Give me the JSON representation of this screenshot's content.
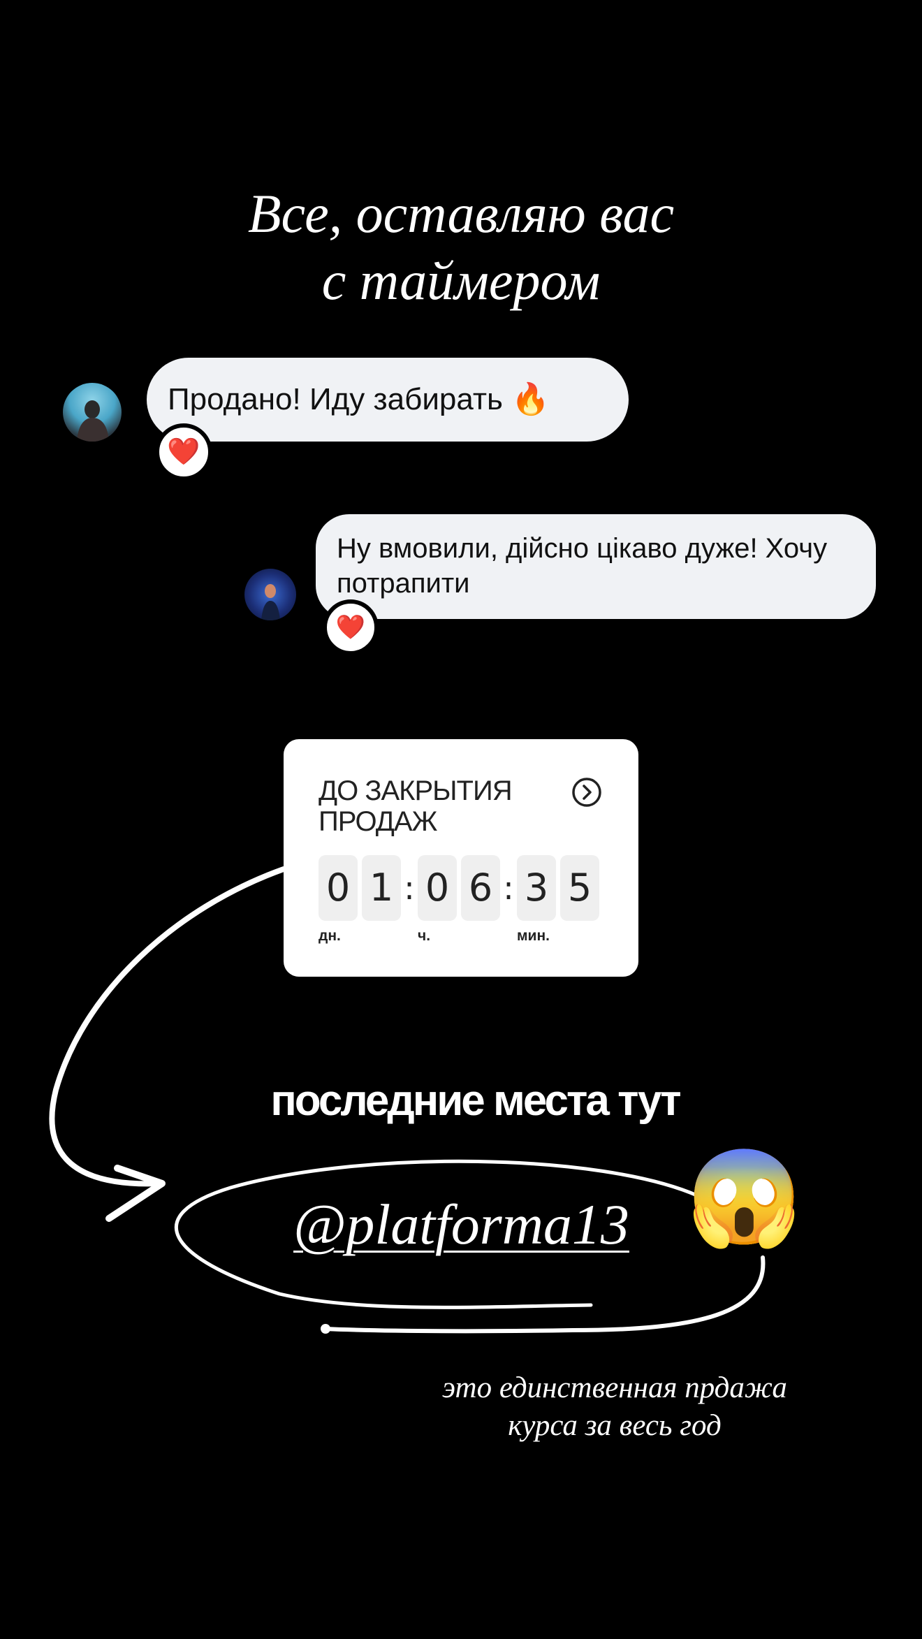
{
  "story": {
    "title_line1": "Все, оставляю вас",
    "title_line2": "с таймером",
    "headline": "последние места тут",
    "handle": "@platforma13",
    "footnote_line1": "это единственная прдажа",
    "footnote_line2": "курса за весь год"
  },
  "messages": [
    {
      "text": "Продано! Иду забирать",
      "emoji": "🔥",
      "reaction": "❤️"
    },
    {
      "text_line1": "Ну вмовили, дійсно цікаво дуже! Хочу",
      "text_line2": "потрапити",
      "reaction": "❤️"
    }
  ],
  "countdown": {
    "title_line1": "ДО ЗАКРЫТИЯ",
    "title_line2": "ПРОДАЖ",
    "days": [
      "0",
      "1"
    ],
    "hours": [
      "0",
      "6"
    ],
    "minutes": [
      "3",
      "5"
    ],
    "separator": ":",
    "unit_days": "дн.",
    "unit_hours": "ч.",
    "unit_minutes": "мин.",
    "icon": "chevron-right-circle-icon"
  },
  "sticker_emoji": "😱",
  "colors": {
    "background": "#000000",
    "bubble": "#f0f2f5",
    "text": "#ffffff",
    "heart": "#e0245e"
  }
}
